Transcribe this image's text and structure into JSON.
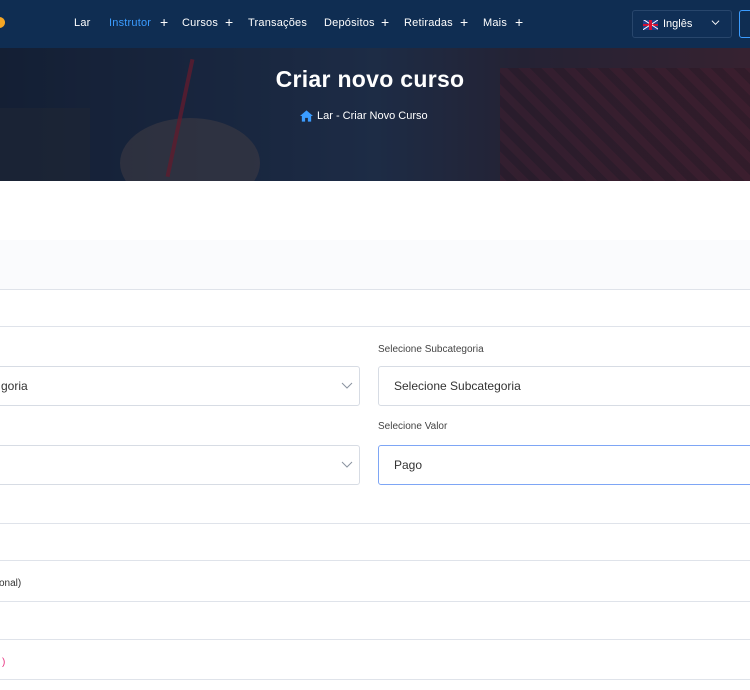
{
  "nav": {
    "items": [
      {
        "label": "Lar",
        "active": false,
        "has_plus": false
      },
      {
        "label": "Instrutor",
        "active": true,
        "has_plus": true
      },
      {
        "label": "Cursos",
        "active": false,
        "has_plus": true
      },
      {
        "label": "Transações",
        "active": false,
        "has_plus": false
      },
      {
        "label": "Depósitos",
        "active": false,
        "has_plus": true
      },
      {
        "label": "Retiradas",
        "active": false,
        "has_plus": true
      },
      {
        "label": "Mais",
        "active": false,
        "has_plus": true
      }
    ],
    "plus_glyph": "+",
    "language": {
      "label": "Inglês",
      "flag_icon": "uk-flag-icon",
      "chevron_icon": "chevron-down-icon"
    },
    "accent_color": "#3b9cff",
    "bar_color": "#0f2d52"
  },
  "hero": {
    "title": "Criar novo curso",
    "breadcrumb": "Lar - Criar Novo Curso",
    "home_icon": "home-icon"
  },
  "form": {
    "category_select_partial": "goria",
    "subcategory": {
      "label": "Selecione Subcategoria",
      "value": "Selecione Subcategoria"
    },
    "price": {
      "label": "Selecione Valor",
      "value": "Pago"
    },
    "optional_partial": "onal)",
    "pink_partial": ")",
    "pink_color": "#e8307f"
  }
}
